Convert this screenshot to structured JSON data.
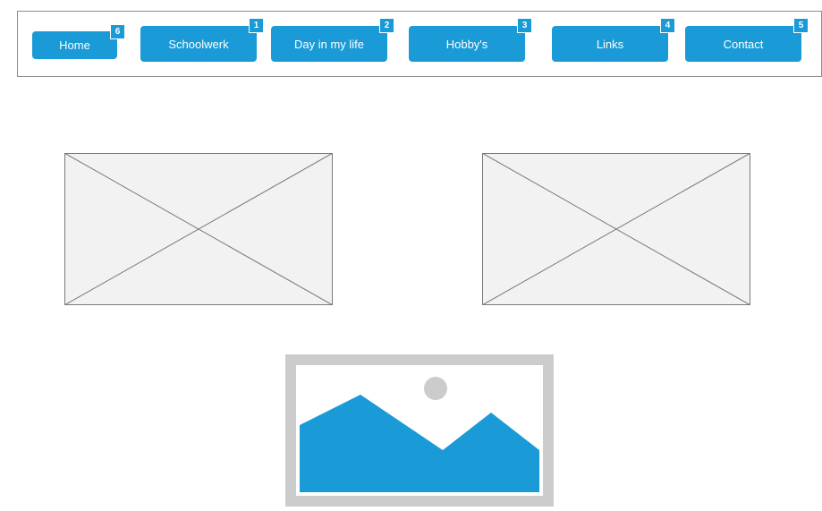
{
  "nav": {
    "items": [
      {
        "label": "Home",
        "badge": "6"
      },
      {
        "label": "Schoolwerk",
        "badge": "1"
      },
      {
        "label": "Day in my life",
        "badge": "2"
      },
      {
        "label": "Hobby's",
        "badge": "3"
      },
      {
        "label": "Links",
        "badge": "4"
      },
      {
        "label": "Contact",
        "badge": "5"
      }
    ]
  },
  "colors": {
    "accent": "#1a9ad6",
    "placeholder_fill": "#f2f2f2",
    "placeholder_stroke": "#7a7a7a",
    "image_frame": "#cccccc"
  },
  "icons": {
    "placeholder": "image-placeholder-x-icon",
    "image": "landscape-image-icon"
  }
}
